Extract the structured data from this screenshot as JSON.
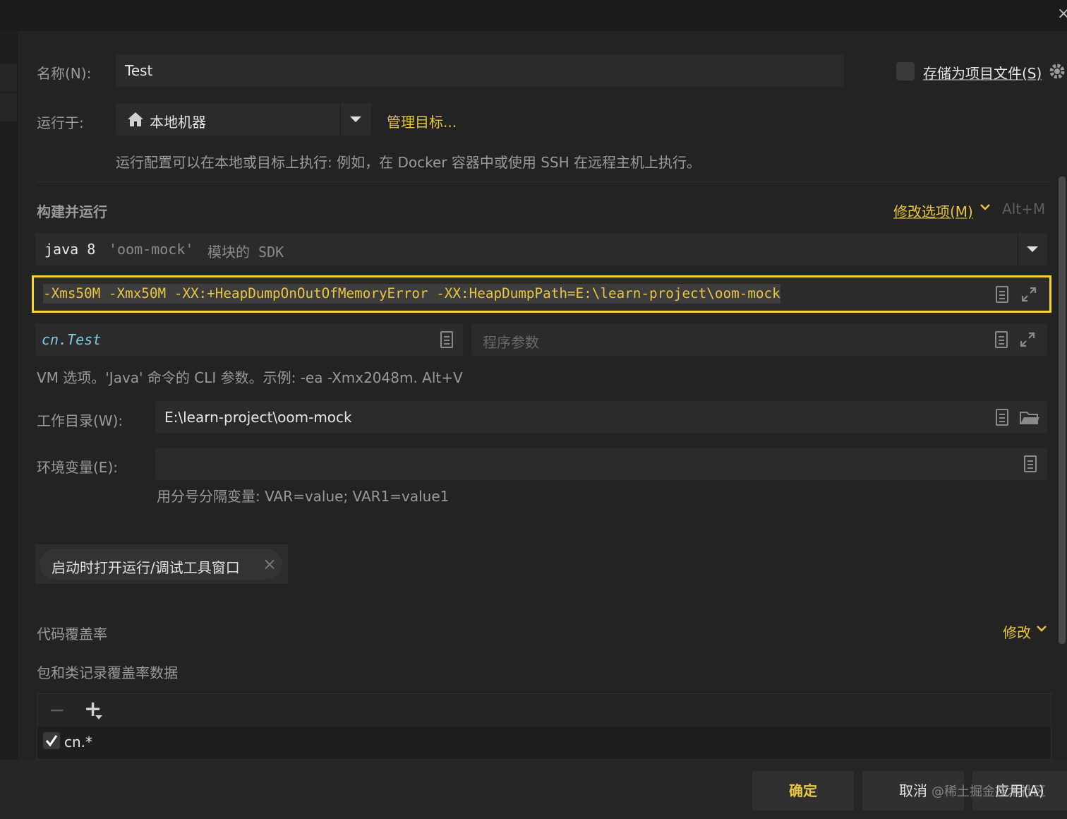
{
  "window": {
    "close_glyph": "×"
  },
  "name_row": {
    "label": "名称(N):",
    "value": "Test",
    "store_checkbox_label": "存储为项目文件(S)",
    "store_checked": false
  },
  "run_on": {
    "label": "运行于:",
    "target": "本地机器",
    "manage_link": "管理目标...",
    "hint": "运行配置可以在本地或目标上执行: 例如，在 Docker 容器中或使用 SSH 在远程主机上执行。"
  },
  "build_run": {
    "section_title": "构建并运行",
    "modify_options": "修改选项(M)",
    "modify_shortcut": "Alt+M",
    "sdk_prefix": "java 8",
    "sdk_module": "'oom-mock'",
    "sdk_suffix": "模块的 SDK",
    "vm_options": "-Xms50M -Xmx50M -XX:+HeapDumpOnOutOfMemoryError -XX:HeapDumpPath=E:\\learn-project\\oom-mock",
    "main_class": "cn.Test",
    "program_args_placeholder": "程序参数",
    "vm_hint": "VM 选项。'Java' 命令的 CLI 参数。示例: -ea -Xmx2048m. Alt+V"
  },
  "working_dir": {
    "label": "工作目录(W):",
    "value": "E:\\learn-project\\oom-mock"
  },
  "env_vars": {
    "label": "环境变量(E):",
    "value": "",
    "hint": "用分号分隔变量: VAR=value; VAR1=value1"
  },
  "chip": {
    "label": "启动时打开运行/调试工具窗口",
    "remove_glyph": "×"
  },
  "coverage": {
    "section_title": "代码覆盖率",
    "modify_link": "修改",
    "subtitle": "包和类记录覆盖率数据",
    "toolbar": {
      "remove_glyph": "−",
      "add_glyph": "+"
    },
    "rows": [
      {
        "checked": true,
        "pattern": "cn.*"
      }
    ]
  },
  "footer": {
    "ok_label": "确定",
    "cancel_label": "取消",
    "apply_label": "应用(A)",
    "watermark": "@稀土掘金技术社区"
  },
  "colors": {
    "accent": "#e8c547",
    "background": "#232323",
    "field": "#2b2b2b",
    "highlight_border": "#f5d33a",
    "selection": "#3d3d3d",
    "main_class": "#7fc8e8"
  }
}
